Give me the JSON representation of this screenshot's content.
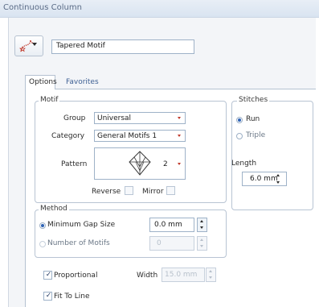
{
  "window": {
    "title": "Continuous Column"
  },
  "toolbar": {
    "motif_name": "Tapered Motif"
  },
  "tabs": [
    {
      "label": "Options"
    },
    {
      "label": "Favorites"
    }
  ],
  "motif": {
    "legend": "Motif",
    "group_label": "Group",
    "group_value": "Universal",
    "category_label": "Category",
    "category_value": "General Motifs 1",
    "pattern_label": "Pattern",
    "pattern_value": "2",
    "reverse_label": "Reverse",
    "mirror_label": "Mirror"
  },
  "stitches": {
    "legend": "Stitches",
    "run_label": "Run",
    "triple_label": "Triple",
    "length_label": "Length",
    "length_value": "6.0 mm"
  },
  "method": {
    "legend": "Method",
    "min_gap_label": "Minimum Gap Size",
    "min_gap_value": "0.0 mm",
    "num_motifs_label": "Number of Motifs",
    "num_motifs_value": "0"
  },
  "proportional": {
    "label": "Proportional",
    "width_label": "Width",
    "width_value": "15.0 mm"
  },
  "fit_to_line": {
    "label": "Fit To Line"
  },
  "colors": {
    "accent": "#2f63b5",
    "link": "#3d5f93",
    "arrow_red": "#c0392b"
  }
}
